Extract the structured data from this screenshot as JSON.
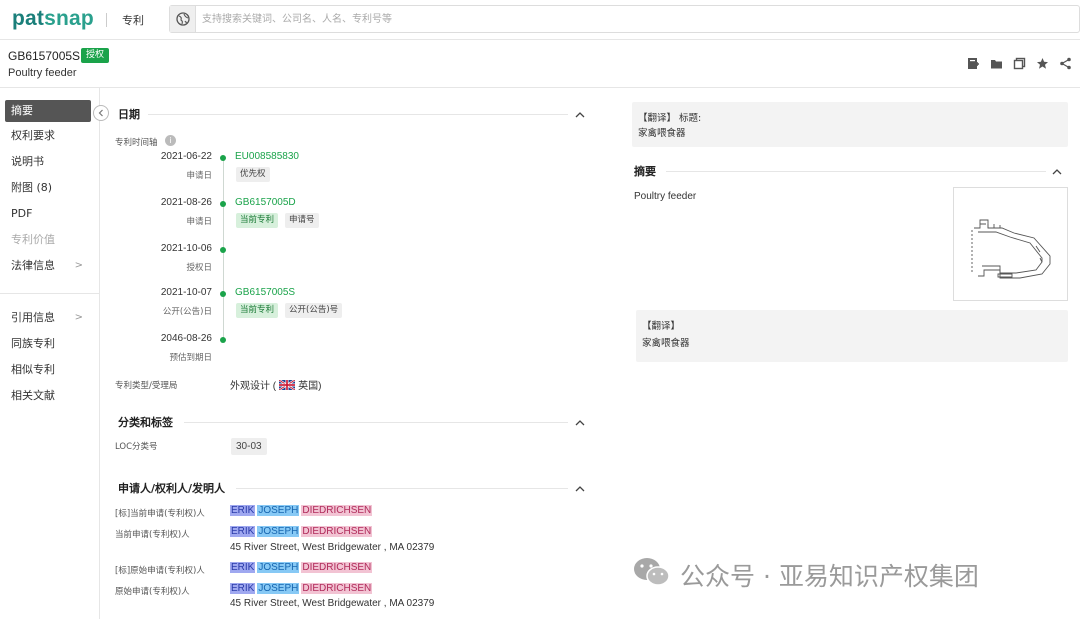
{
  "brand": {
    "part1": "pat",
    "part2": "snap"
  },
  "top_nav": {
    "label": "专利"
  },
  "search": {
    "placeholder": "支持搜索关键词、公司名、人名、专利号等"
  },
  "patent": {
    "pub_number": "GB6157005S",
    "status_badge": "授权",
    "title": "Poultry feeder"
  },
  "header_icons": [
    "export-icon",
    "folder-icon",
    "copy-icon",
    "star-icon",
    "share-icon"
  ],
  "sidebar": {
    "items": [
      {
        "label": "摘要",
        "active": true
      },
      {
        "label": "权利要求"
      },
      {
        "label": "说明书"
      },
      {
        "label": "附图 (8)"
      },
      {
        "label": "PDF"
      },
      {
        "label": "专利价值",
        "disabled": true
      },
      {
        "label": "法律信息",
        "chevron": ">"
      },
      {
        "label": "引用信息",
        "chevron": ">"
      },
      {
        "label": "同族专利"
      },
      {
        "label": "相似专利"
      },
      {
        "label": "相关文献"
      }
    ]
  },
  "dates": {
    "heading": "日期",
    "timeline_label": "专利时间轴",
    "events": [
      {
        "date": "2021-06-22",
        "sub": "申请日",
        "number": "EU008585830",
        "tags": [
          {
            "text": "优先权",
            "style": "gray"
          }
        ]
      },
      {
        "date": "2021-08-26",
        "sub": "申请日",
        "number": "GB6157005D",
        "tags": [
          {
            "text": "当前专利",
            "style": "green"
          },
          {
            "text": "申请号",
            "style": "gray"
          }
        ]
      },
      {
        "date": "2021-10-06",
        "sub": "授权日",
        "number": "",
        "tags": []
      },
      {
        "date": "2021-10-07",
        "sub": "公开(公告)日",
        "number": "GB6157005S",
        "tags": [
          {
            "text": "当前专利",
            "style": "green"
          },
          {
            "text": "公开(公告)号",
            "style": "gray"
          }
        ]
      },
      {
        "date": "2046-08-26",
        "sub": "预估到期日",
        "number": "",
        "tags": []
      }
    ],
    "type_label": "专利类型/受理局",
    "type_value": "外观设计 (",
    "country": "英国)"
  },
  "classification": {
    "heading": "分类和标签",
    "loc_label": "LOC分类号",
    "loc_value": "30-03"
  },
  "applicants": {
    "heading": "申请人/权利人/发明人",
    "rows": [
      {
        "label": "[标]当前申请(专利权)人",
        "name": [
          "ERIK",
          "JOSEPH",
          "DIEDRICHSEN"
        ],
        "address": ""
      },
      {
        "label": "当前申请(专利权)人",
        "name": [
          "ERIK",
          "JOSEPH",
          "DIEDRICHSEN"
        ],
        "address": "45 River Street, West Bridgewater , MA 02379"
      },
      {
        "label": "[标]原始申请(专利权)人",
        "name": [
          "ERIK",
          "JOSEPH",
          "DIEDRICHSEN"
        ],
        "address": ""
      },
      {
        "label": "原始申请(专利权)人",
        "name": [
          "ERIK",
          "JOSEPH",
          "DIEDRICHSEN"
        ],
        "address": "45 River Street, West Bridgewater , MA 02379"
      }
    ]
  },
  "right": {
    "translate_title": {
      "tag": "【翻译】",
      "label": "标题:",
      "value": "家禽喂食器"
    },
    "abstract": {
      "heading": "摘要",
      "text": "Poultry feeder"
    },
    "translate_abstract": {
      "tag": "【翻译】",
      "value": "家禽喂食器"
    }
  },
  "watermark": {
    "text": "公众号 · 亚易知识产权集团"
  },
  "colors": {
    "accent_green": "#1aa34a",
    "brand_teal": "#1a7f7a"
  }
}
